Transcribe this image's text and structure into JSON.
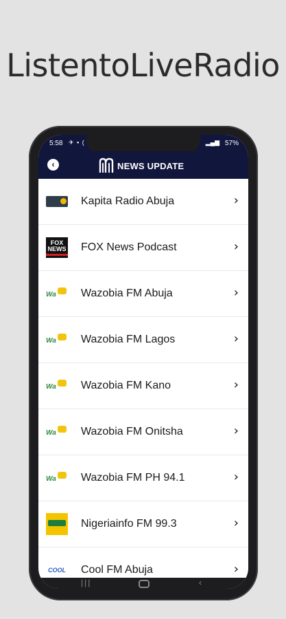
{
  "promo": {
    "title": "ListentoLiveRadio"
  },
  "status_bar": {
    "time": "5:58",
    "battery": "57%"
  },
  "app_bar": {
    "title": "NEWS UPDATE"
  },
  "stations": [
    {
      "name": "Kapita Radio Abuja",
      "logo": "kapita-logo"
    },
    {
      "name": "FOX News Podcast",
      "logo": "fox-news-logo"
    },
    {
      "name": "Wazobia FM Abuja",
      "logo": "wazobia-logo"
    },
    {
      "name": "Wazobia FM Lagos",
      "logo": "wazobia-logo"
    },
    {
      "name": "Wazobia FM Kano",
      "logo": "wazobia-logo"
    },
    {
      "name": "Wazobia FM Onitsha",
      "logo": "wazobia-logo"
    },
    {
      "name": "Wazobia FM PH 94.1",
      "logo": "wazobia-logo"
    },
    {
      "name": "Nigeriainfo FM 99.3",
      "logo": "nigeriainfo-logo"
    },
    {
      "name": "Cool FM Abuja",
      "logo": "cool-fm-logo"
    }
  ],
  "colors": {
    "app_bar": "#11163d",
    "background": "#e3e3e3",
    "phone_frame": "#1d1d1f"
  }
}
